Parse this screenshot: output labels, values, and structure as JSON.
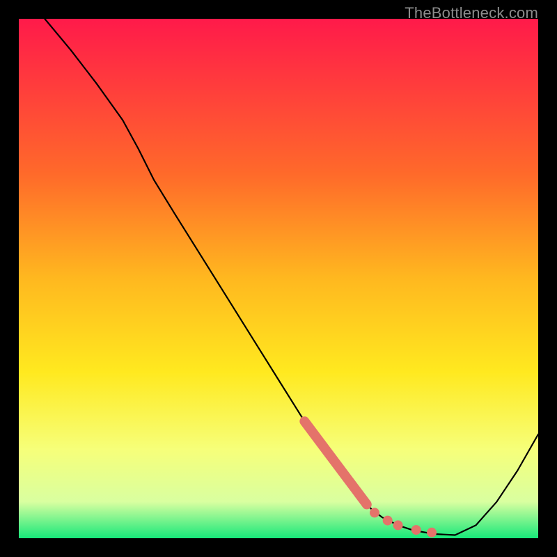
{
  "watermark": "TheBottleneck.com",
  "colors": {
    "gradient_top": "#ff1a4a",
    "gradient_mid1": "#ff6a2a",
    "gradient_mid2": "#ffb81f",
    "gradient_mid3": "#ffe91f",
    "gradient_mid4": "#f6ff7a",
    "gradient_mid5": "#d9ffa0",
    "gradient_bottom": "#17e87a",
    "curve": "#000000",
    "marker": "#e4736a"
  },
  "chart_data": {
    "type": "line",
    "title": "",
    "xlabel": "",
    "ylabel": "",
    "xlim": [
      0,
      100
    ],
    "ylim": [
      0,
      100
    ],
    "curve": {
      "x": [
        5,
        10,
        15,
        20,
        23,
        26,
        30,
        35,
        40,
        45,
        50,
        55,
        60,
        65,
        68,
        70,
        73,
        76,
        80,
        84,
        88,
        92,
        96,
        100
      ],
      "y": [
        100,
        94,
        87.5,
        80.5,
        75,
        69,
        62.5,
        54.5,
        46.5,
        38.5,
        30.5,
        22.5,
        15,
        8.5,
        5.5,
        4,
        2.5,
        1.5,
        0.8,
        0.6,
        2.5,
        7,
        13,
        20
      ]
    },
    "thick_segment": {
      "x": [
        55,
        67
      ],
      "y": [
        22.5,
        6.5
      ]
    },
    "dotted_segment": {
      "points": [
        {
          "x": 68.5,
          "y": 4.9
        },
        {
          "x": 71.0,
          "y": 3.4
        },
        {
          "x": 73.0,
          "y": 2.5
        },
        {
          "x": 76.5,
          "y": 1.6
        },
        {
          "x": 79.5,
          "y": 1.1
        }
      ]
    }
  }
}
